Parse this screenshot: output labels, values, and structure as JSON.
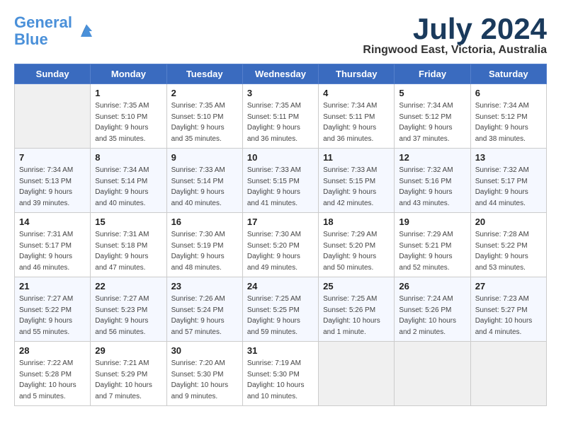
{
  "logo": {
    "line1": "General",
    "line2": "Blue"
  },
  "title": "July 2024",
  "location": "Ringwood East, Victoria, Australia",
  "weekdays": [
    "Sunday",
    "Monday",
    "Tuesday",
    "Wednesday",
    "Thursday",
    "Friday",
    "Saturday"
  ],
  "weeks": [
    [
      {
        "day": "",
        "info": ""
      },
      {
        "day": "1",
        "info": "Sunrise: 7:35 AM\nSunset: 5:10 PM\nDaylight: 9 hours\nand 35 minutes."
      },
      {
        "day": "2",
        "info": "Sunrise: 7:35 AM\nSunset: 5:10 PM\nDaylight: 9 hours\nand 35 minutes."
      },
      {
        "day": "3",
        "info": "Sunrise: 7:35 AM\nSunset: 5:11 PM\nDaylight: 9 hours\nand 36 minutes."
      },
      {
        "day": "4",
        "info": "Sunrise: 7:34 AM\nSunset: 5:11 PM\nDaylight: 9 hours\nand 36 minutes."
      },
      {
        "day": "5",
        "info": "Sunrise: 7:34 AM\nSunset: 5:12 PM\nDaylight: 9 hours\nand 37 minutes."
      },
      {
        "day": "6",
        "info": "Sunrise: 7:34 AM\nSunset: 5:12 PM\nDaylight: 9 hours\nand 38 minutes."
      }
    ],
    [
      {
        "day": "7",
        "info": "Sunrise: 7:34 AM\nSunset: 5:13 PM\nDaylight: 9 hours\nand 39 minutes."
      },
      {
        "day": "8",
        "info": "Sunrise: 7:34 AM\nSunset: 5:14 PM\nDaylight: 9 hours\nand 40 minutes."
      },
      {
        "day": "9",
        "info": "Sunrise: 7:33 AM\nSunset: 5:14 PM\nDaylight: 9 hours\nand 40 minutes."
      },
      {
        "day": "10",
        "info": "Sunrise: 7:33 AM\nSunset: 5:15 PM\nDaylight: 9 hours\nand 41 minutes."
      },
      {
        "day": "11",
        "info": "Sunrise: 7:33 AM\nSunset: 5:15 PM\nDaylight: 9 hours\nand 42 minutes."
      },
      {
        "day": "12",
        "info": "Sunrise: 7:32 AM\nSunset: 5:16 PM\nDaylight: 9 hours\nand 43 minutes."
      },
      {
        "day": "13",
        "info": "Sunrise: 7:32 AM\nSunset: 5:17 PM\nDaylight: 9 hours\nand 44 minutes."
      }
    ],
    [
      {
        "day": "14",
        "info": "Sunrise: 7:31 AM\nSunset: 5:17 PM\nDaylight: 9 hours\nand 46 minutes."
      },
      {
        "day": "15",
        "info": "Sunrise: 7:31 AM\nSunset: 5:18 PM\nDaylight: 9 hours\nand 47 minutes."
      },
      {
        "day": "16",
        "info": "Sunrise: 7:30 AM\nSunset: 5:19 PM\nDaylight: 9 hours\nand 48 minutes."
      },
      {
        "day": "17",
        "info": "Sunrise: 7:30 AM\nSunset: 5:20 PM\nDaylight: 9 hours\nand 49 minutes."
      },
      {
        "day": "18",
        "info": "Sunrise: 7:29 AM\nSunset: 5:20 PM\nDaylight: 9 hours\nand 50 minutes."
      },
      {
        "day": "19",
        "info": "Sunrise: 7:29 AM\nSunset: 5:21 PM\nDaylight: 9 hours\nand 52 minutes."
      },
      {
        "day": "20",
        "info": "Sunrise: 7:28 AM\nSunset: 5:22 PM\nDaylight: 9 hours\nand 53 minutes."
      }
    ],
    [
      {
        "day": "21",
        "info": "Sunrise: 7:27 AM\nSunset: 5:22 PM\nDaylight: 9 hours\nand 55 minutes."
      },
      {
        "day": "22",
        "info": "Sunrise: 7:27 AM\nSunset: 5:23 PM\nDaylight: 9 hours\nand 56 minutes."
      },
      {
        "day": "23",
        "info": "Sunrise: 7:26 AM\nSunset: 5:24 PM\nDaylight: 9 hours\nand 57 minutes."
      },
      {
        "day": "24",
        "info": "Sunrise: 7:25 AM\nSunset: 5:25 PM\nDaylight: 9 hours\nand 59 minutes."
      },
      {
        "day": "25",
        "info": "Sunrise: 7:25 AM\nSunset: 5:26 PM\nDaylight: 10 hours\nand 1 minute."
      },
      {
        "day": "26",
        "info": "Sunrise: 7:24 AM\nSunset: 5:26 PM\nDaylight: 10 hours\nand 2 minutes."
      },
      {
        "day": "27",
        "info": "Sunrise: 7:23 AM\nSunset: 5:27 PM\nDaylight: 10 hours\nand 4 minutes."
      }
    ],
    [
      {
        "day": "28",
        "info": "Sunrise: 7:22 AM\nSunset: 5:28 PM\nDaylight: 10 hours\nand 5 minutes."
      },
      {
        "day": "29",
        "info": "Sunrise: 7:21 AM\nSunset: 5:29 PM\nDaylight: 10 hours\nand 7 minutes."
      },
      {
        "day": "30",
        "info": "Sunrise: 7:20 AM\nSunset: 5:30 PM\nDaylight: 10 hours\nand 9 minutes."
      },
      {
        "day": "31",
        "info": "Sunrise: 7:19 AM\nSunset: 5:30 PM\nDaylight: 10 hours\nand 10 minutes."
      },
      {
        "day": "",
        "info": ""
      },
      {
        "day": "",
        "info": ""
      },
      {
        "day": "",
        "info": ""
      }
    ]
  ]
}
